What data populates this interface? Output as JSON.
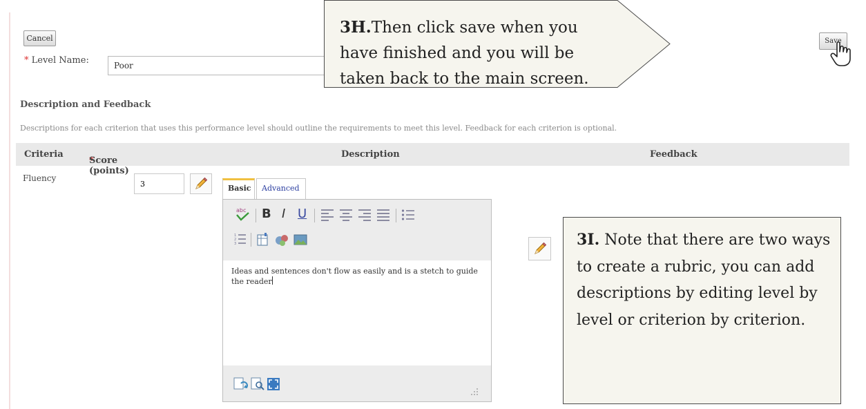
{
  "form": {
    "cancel_label": "Cancel",
    "save_label": "Save",
    "required_mark": "*",
    "level_name_label": "Level Name:",
    "level_name_value": "Poor"
  },
  "section": {
    "title": "Description and Feedback",
    "instructions": "Descriptions for each criterion that uses this performance level should outline the requirements to meet this level. Feedback for each criterion is optional."
  },
  "table": {
    "headers": {
      "criteria": "Criteria",
      "score_required": "*",
      "score": "Score (points)",
      "description": "Description",
      "feedback": "Feedback"
    },
    "row": {
      "criterion": "Fluency",
      "score": "3",
      "description_text": "Ideas and sentences don't flow as easily and is a stetch to guide the reader"
    }
  },
  "editor": {
    "tab_basic": "Basic",
    "tab_advanced": "Advanced",
    "toolbar": {
      "bold": "B",
      "italic": "I",
      "underline": "U"
    }
  },
  "callouts": {
    "step_3h": {
      "label": "3H.",
      "text": "Then click save when you have finished and you will be taken back to the main screen."
    },
    "step_3i": {
      "label": "3I.",
      "text": " Note that there are two ways to create a rubric, you can add descriptions by editing level by level or criterion by criterion."
    }
  },
  "colors": {
    "callout_bg": "#f6f5ee",
    "required": "#dd3333",
    "header_bg": "#e9e9e9",
    "tab_accent": "#f0c040",
    "advanced_link": "#2b3ea0"
  },
  "icons": [
    "pencil-icon",
    "spellcheck-icon",
    "align-left-icon",
    "align-center-icon",
    "align-right-icon",
    "align-justify-icon",
    "bullet-list-icon",
    "numbered-list-icon",
    "insert-table-icon",
    "insert-image-icon",
    "insert-equation-icon",
    "preview-icon",
    "fullscreen-icon",
    "resize-grip-icon",
    "hand-cursor-icon"
  ]
}
